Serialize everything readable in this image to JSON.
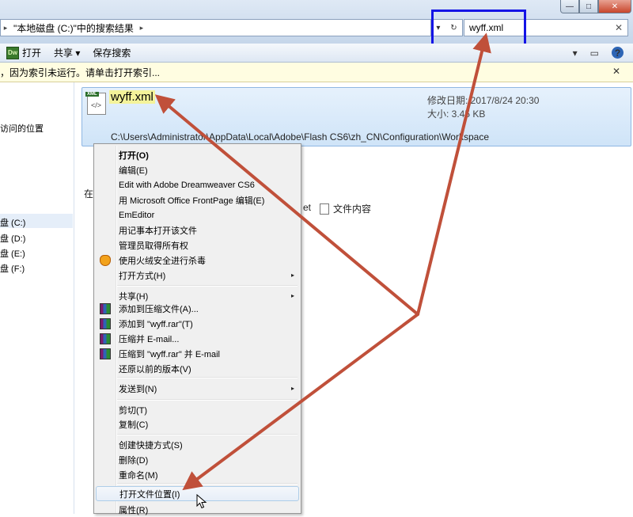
{
  "window": {
    "minimize_label": "—",
    "maximize_label": "□",
    "close_label": "✕"
  },
  "address": {
    "arrow_left": "▸",
    "crumb": "\"本地磁盘 (C:)\"中的搜索结果",
    "arrow_right": "▸",
    "dropdown": "▾",
    "refresh": "↻"
  },
  "search": {
    "value": "wyff.xml",
    "clear": "✕"
  },
  "toolbar": {
    "dw_label": "Dw",
    "open_label": "打开",
    "share_label": "共享 ▾",
    "save_search_label": "保存搜索",
    "view_label": "▾",
    "pane_label": "▭",
    "help_label": "?"
  },
  "infobar": {
    "text": "，因为索引未运行。请单击打开索引...",
    "close": "✕"
  },
  "nav": {
    "items": [
      "访问的位置",
      "盘 (C:)",
      "盘 (D:)",
      "盘 (E:)",
      "盘 (F:)"
    ]
  },
  "result": {
    "filename": "wyff.xml",
    "modified": "修改日期: 2017/8/24 20:30",
    "size": "大小: 3.45 KB",
    "path": "C:\\Users\\Administrator\\AppData\\Local\\Adobe\\Flash CS6\\zh_CN\\Configuration\\Workspace",
    "lower_prefix": "在",
    "lower_et": "et",
    "file_content": "文件内容",
    "xml_tag": "XML",
    "xml_code": "</>"
  },
  "context_menu": {
    "items": [
      {
        "label": "打开(O)",
        "bold": true
      },
      {
        "label": "编辑(E)"
      },
      {
        "label": "Edit with Adobe Dreamweaver CS6"
      },
      {
        "label": "用 Microsoft Office FrontPage 编辑(E)"
      },
      {
        "label": "EmEditor"
      },
      {
        "label": "用记事本打开该文件"
      },
      {
        "label": "管理员取得所有权"
      },
      {
        "label": "使用火绒安全进行杀毒",
        "icon": "shield-icon"
      },
      {
        "label": "打开方式(H)",
        "submenu": true
      },
      {
        "label": "共享(H)",
        "submenu": true
      },
      {
        "label": "添加到压缩文件(A)...",
        "icon": "winrar-icon"
      },
      {
        "label": "添加到 \"wyff.rar\"(T)",
        "icon": "winrar-icon"
      },
      {
        "label": "压缩并 E-mail...",
        "icon": "winrar-icon"
      },
      {
        "label": "压缩到 \"wyff.rar\" 并 E-mail",
        "icon": "winrar-icon"
      },
      {
        "label": "还原以前的版本(V)"
      },
      {
        "label": "发送到(N)",
        "submenu": true
      },
      {
        "label": "剪切(T)"
      },
      {
        "label": "复制(C)"
      },
      {
        "label": "创建快捷方式(S)"
      },
      {
        "label": "删除(D)"
      },
      {
        "label": "重命名(M)"
      },
      {
        "label": "打开文件位置(I)",
        "hover": true
      },
      {
        "label": "属性(R)"
      }
    ],
    "submenu_arrow": "▸"
  },
  "annotation_colors": {
    "arrow": "#c0503a",
    "highlight_box": "#1414e6",
    "filename_highlight": "#f4f39a"
  }
}
